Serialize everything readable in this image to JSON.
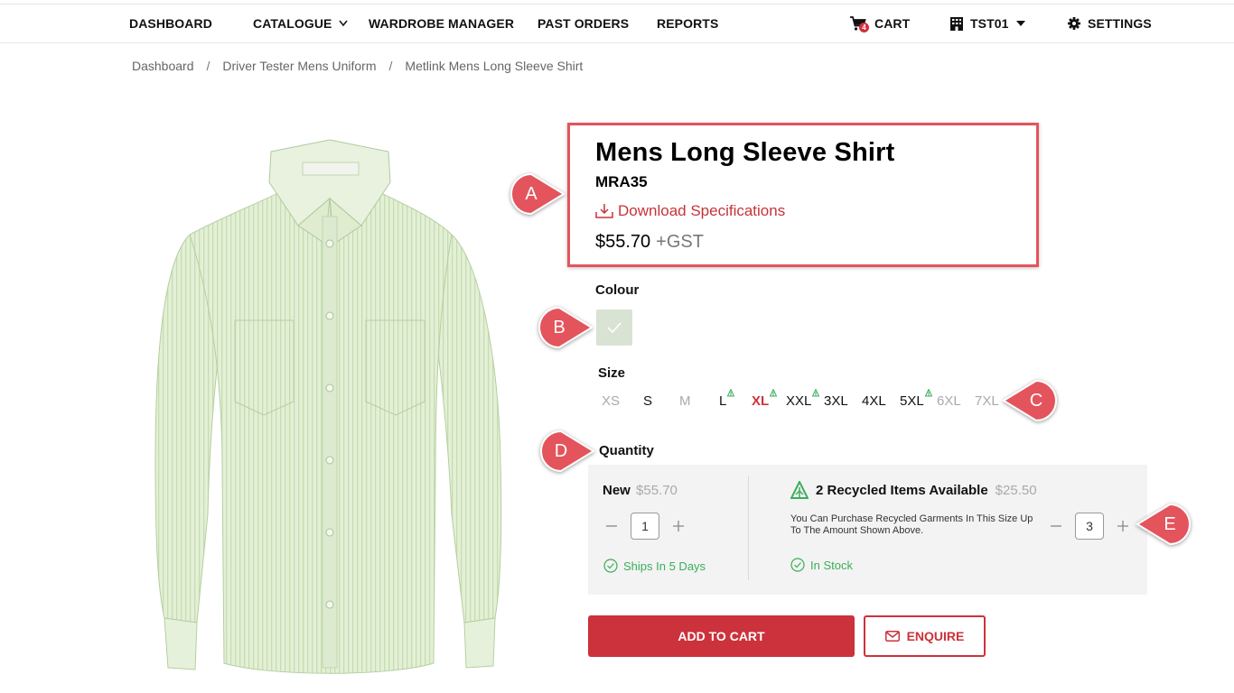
{
  "nav": {
    "dashboard": "DASHBOARD",
    "catalogue": "CATALOGUE",
    "wardrobe_manager": "WARDROBE MANAGER",
    "past_orders": "PAST ORDERS",
    "reports": "REPORTS",
    "cart": "CART",
    "cart_count": "4",
    "account": "TST01",
    "settings": "SETTINGS"
  },
  "breadcrumb": {
    "items": [
      "Dashboard",
      "Driver Tester Mens Uniform",
      "Metlink Mens Long Sleeve Shirt"
    ],
    "separator": "/"
  },
  "product": {
    "title": "Mens Long Sleeve Shirt",
    "sku": "MRA35",
    "download_label": "Download Specifications",
    "price": "$55.70",
    "tax_suffix": "+GST",
    "image_icon": "shirt-image"
  },
  "colour": {
    "label": "Colour",
    "selected_swatch": "#d9e3d3"
  },
  "size": {
    "label": "Size",
    "options": [
      "XS",
      "S",
      "M",
      "L",
      "XL",
      "XXL",
      "3XL",
      "4XL",
      "5XL",
      "6XL",
      "7XL"
    ],
    "unavailable": [
      "XS",
      "M",
      "6XL",
      "7XL"
    ],
    "recycled_available": [
      "L",
      "XL",
      "XXL",
      "5XL"
    ],
    "selected": "XL"
  },
  "quantity": {
    "label": "Quantity",
    "new": {
      "title": "New",
      "price": "$55.70",
      "value": "1",
      "status": "Ships In 5 Days"
    },
    "recycled": {
      "title": "2 Recycled Items Available",
      "price": "$25.50",
      "description": "You Can Purchase Recycled Garments In This Size Up To The Amount Shown Above.",
      "value": "3",
      "status": "In Stock"
    }
  },
  "actions": {
    "add_to_cart": "ADD TO CART",
    "enquire": "ENQUIRE"
  },
  "annotations": {
    "a": "A",
    "b": "B",
    "c": "C",
    "d": "D",
    "e": "E"
  },
  "colors": {
    "accent_red": "#cc323b",
    "recycled_green": "#3bae5b",
    "annotation_red": "#e3545c"
  }
}
